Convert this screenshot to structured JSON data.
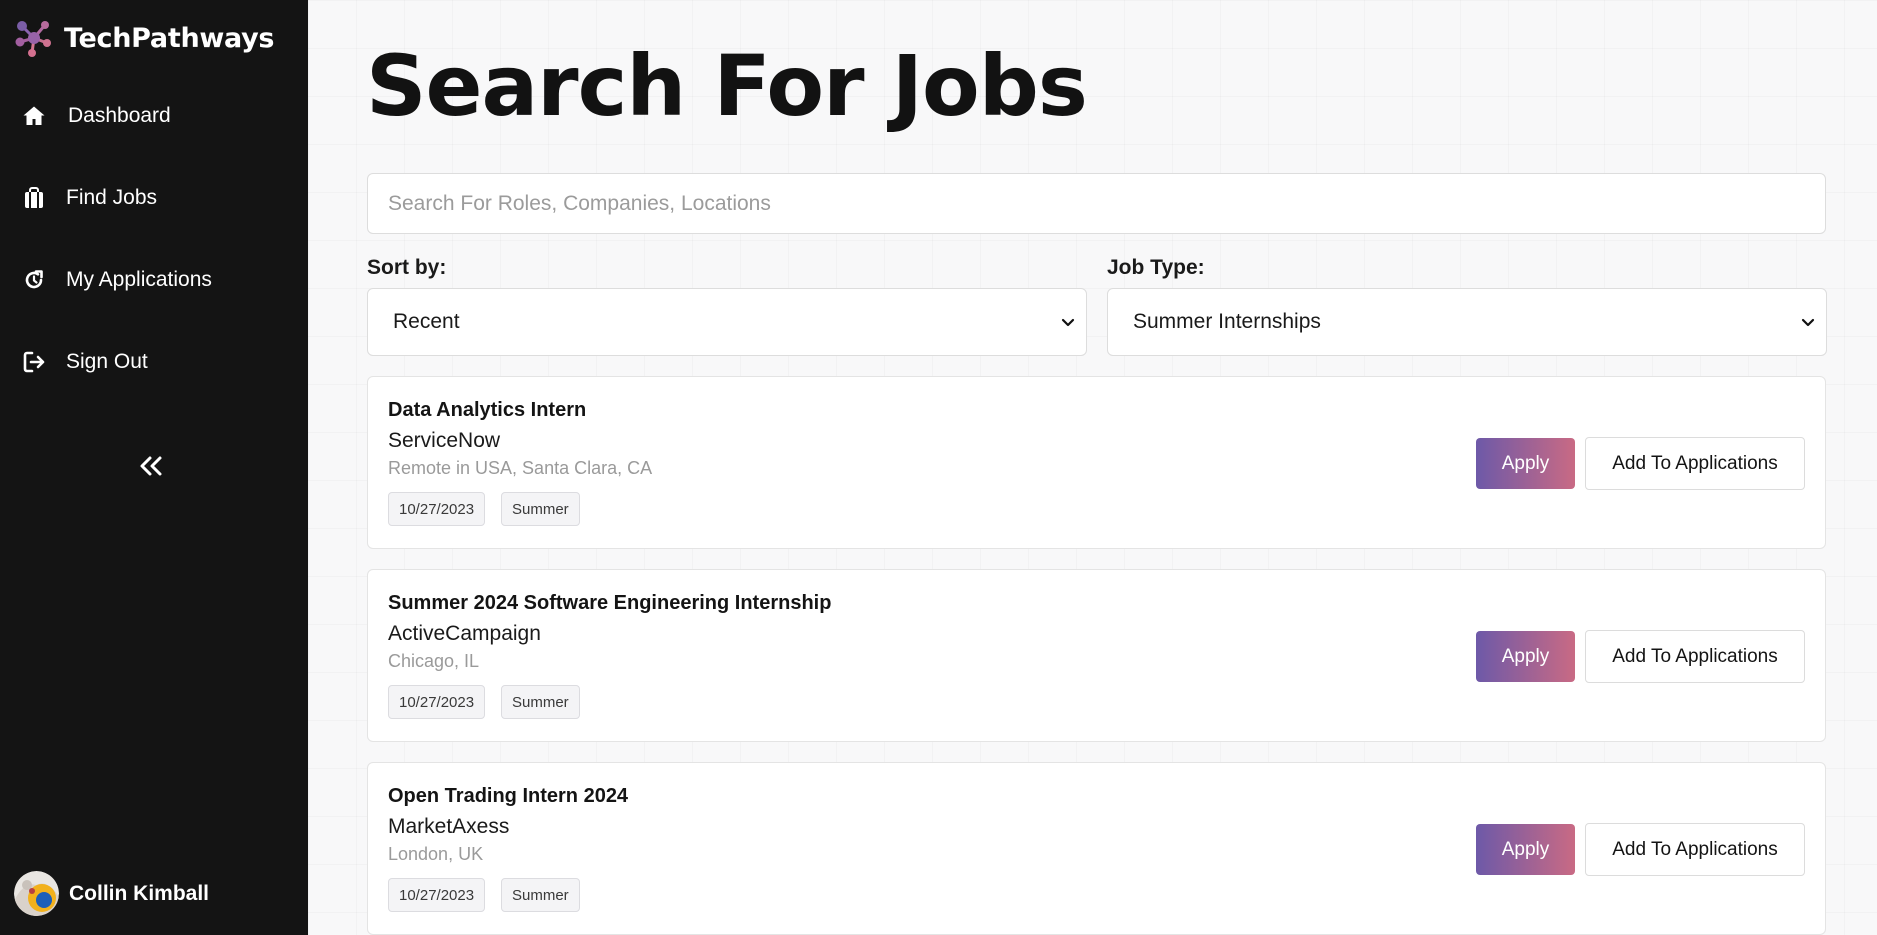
{
  "sidebar": {
    "brand": {
      "name": "TechPathways",
      "icon": "molecule-logo-icon"
    },
    "items": [
      {
        "label": "Dashboard",
        "icon": "home-icon"
      },
      {
        "label": "Find Jobs",
        "icon": "briefcase-icon"
      },
      {
        "label": "My Applications",
        "icon": "refresh-icon"
      },
      {
        "label": "Sign Out",
        "icon": "sign-out-icon"
      }
    ],
    "collapse_label": "<<",
    "user": {
      "name": "Collin Kimball"
    }
  },
  "main": {
    "title": "Search For Jobs",
    "search": {
      "placeholder": "Search For Roles, Companies, Locations",
      "value": ""
    },
    "filters": {
      "sort": {
        "label": "Sort by:",
        "value": "Recent"
      },
      "job_type": {
        "label": "Job Type:",
        "value": "Summer Internships"
      }
    },
    "jobs": [
      {
        "title": "Data Analytics Intern",
        "company": "ServiceNow",
        "location": "Remote in USA, Santa Clara, CA",
        "date": "10/27/2023",
        "tag": "Summer",
        "apply_label": "Apply",
        "add_label": "Add To Applications"
      },
      {
        "title": "Summer 2024 Software Engineering Internship",
        "company": "ActiveCampaign",
        "location": "Chicago, IL",
        "date": "10/27/2023",
        "tag": "Summer",
        "apply_label": "Apply",
        "add_label": "Add To Applications"
      },
      {
        "title": "Open Trading Intern 2024",
        "company": "MarketAxess",
        "location": "London, UK",
        "date": "10/27/2023",
        "tag": "Summer",
        "apply_label": "Apply",
        "add_label": "Add To Applications"
      }
    ]
  },
  "colors": {
    "sidebar_bg": "#141414",
    "apply_gradient_start": "#6d59a8",
    "apply_gradient_end": "#c96a84",
    "logo_purple": "#7b5ea7",
    "logo_pink": "#d4708f"
  }
}
